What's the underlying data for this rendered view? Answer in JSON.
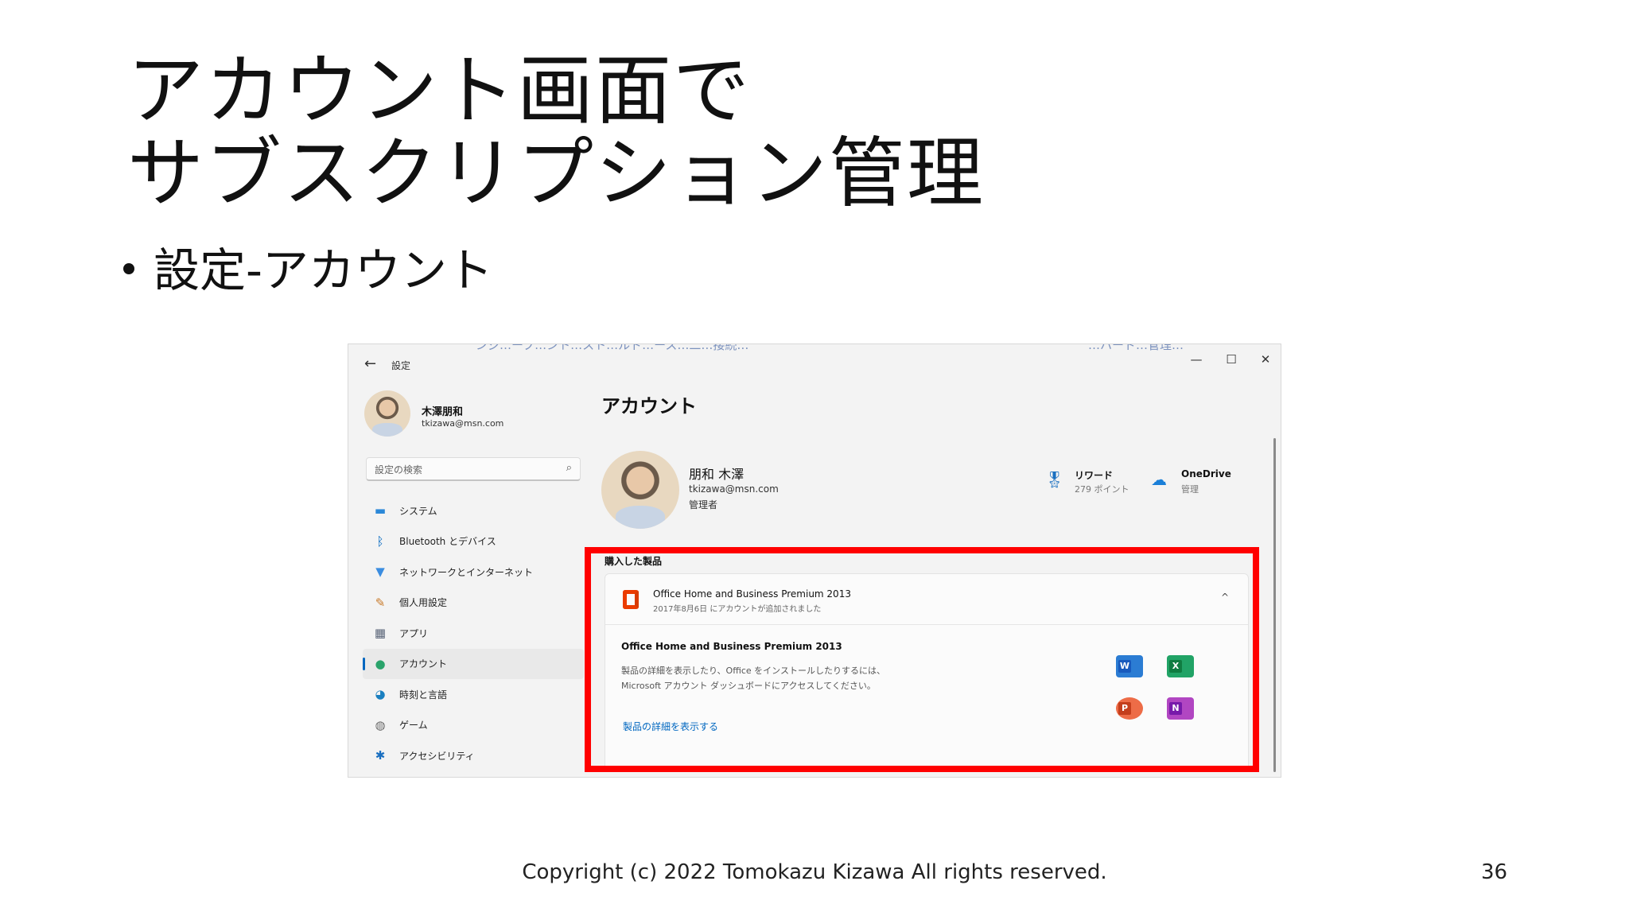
{
  "slide": {
    "title_line1": "アカウント画面で",
    "title_line2": "サブスクリプション管理",
    "bullet": "設定-アカウント",
    "footer": "Copyright (c) 2022 Tomokazu Kizawa All rights reserved.",
    "page_number": "36"
  },
  "window": {
    "app_title": "設定",
    "controls": {
      "minimize": "—",
      "maximize": "☐",
      "close": "✕"
    },
    "cutoff_text_left": "ンジ…ープ…ント…スト…ルド…ース…二…接続…",
    "cutoff_text_right": "…ハード…管理…",
    "back_icon": "←"
  },
  "sidebar": {
    "user_name": "木澤朋和",
    "user_email": "tkizawa@msn.com",
    "search_placeholder": "設定の検索",
    "search_icon": "🔍",
    "items": [
      {
        "label": "システム",
        "icon": "monitor-icon",
        "glyph": "▬",
        "color": "#2b88d8"
      },
      {
        "label": "Bluetooth とデバイス",
        "icon": "bluetooth-icon",
        "glyph": "ᛒ",
        "color": "#0067c0"
      },
      {
        "label": "ネットワークとインターネット",
        "icon": "wifi-icon",
        "glyph": "▼",
        "color": "#3b8de0"
      },
      {
        "label": "個人用設定",
        "icon": "brush-icon",
        "glyph": "✎",
        "color": "#c87a2a"
      },
      {
        "label": "アプリ",
        "icon": "apps-icon",
        "glyph": "▦",
        "color": "#5a6578"
      },
      {
        "label": "アカウント",
        "icon": "person-icon",
        "glyph": "●",
        "color": "#2aa36b",
        "active": true
      },
      {
        "label": "時刻と言語",
        "icon": "globe-icon",
        "glyph": "◕",
        "color": "#1a7fc0"
      },
      {
        "label": "ゲーム",
        "icon": "gamepad-icon",
        "glyph": "◍",
        "color": "#6a6a6a"
      },
      {
        "label": "アクセシビリティ",
        "icon": "accessibility-icon",
        "glyph": "✱",
        "color": "#1a6fc0"
      }
    ]
  },
  "main": {
    "heading": "アカウント",
    "profile": {
      "name": "朋和 木澤",
      "email": "tkizawa@msn.com",
      "role": "管理者"
    },
    "tiles": [
      {
        "title": "リワード",
        "subtitle": "279 ポイント",
        "icon": "rewards-icon",
        "glyph": "🎖"
      },
      {
        "title": "OneDrive",
        "subtitle": "管理",
        "icon": "cloud-icon",
        "glyph": "☁"
      }
    ],
    "section_label": "購入した製品",
    "product": {
      "title": "Office Home and Business Premium 2013",
      "date": "2017年8月6日 にアカウントが追加されました",
      "chevron": "^",
      "detail_title": "Office Home and Business Premium 2013",
      "detail_desc_line1": "製品の詳細を表示したり、Office をインストールしたりするには、",
      "detail_desc_line2": "Microsoft アカウント ダッシュボードにアクセスしてください。",
      "link": "製品の詳細を表示する",
      "apps": [
        {
          "name": "word-icon",
          "letter": "W",
          "bg": "#2b7cd3",
          "badge": "#185abd"
        },
        {
          "name": "excel-icon",
          "letter": "X",
          "bg": "#21a366",
          "badge": "#107c41"
        },
        {
          "name": "powerpoint-icon",
          "letter": "P",
          "bg": "#ed6c47",
          "badge": "#c43e1c"
        },
        {
          "name": "onenote-icon",
          "letter": "N",
          "bg": "#b146c2",
          "badge": "#7719aa"
        }
      ]
    }
  },
  "colors": {
    "highlight_box": "#ff0000",
    "accent": "#0067c0"
  }
}
